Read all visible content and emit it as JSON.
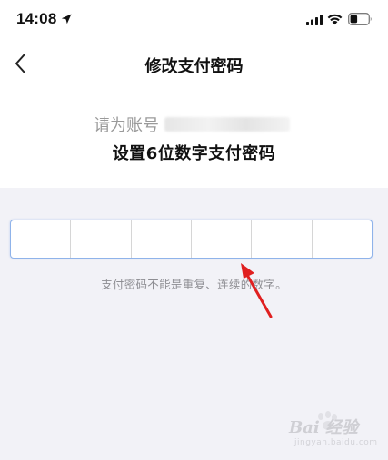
{
  "status_bar": {
    "time": "14:08"
  },
  "nav": {
    "title": "修改支付密码"
  },
  "prompt": {
    "prefix": "请为账号",
    "main": "设置6位数字支付密码"
  },
  "pin": {
    "length": 6
  },
  "hint": {
    "text": "支付密码不能是重复、连续的数字。"
  },
  "watermark": {
    "logo": "Bai 经验",
    "url": "jingyan.baidu.com"
  },
  "colors": {
    "page_bg": "#f2f2f7",
    "card_bg": "#ffffff",
    "pin_border": "#8fb3ea",
    "hint": "#8e8e93",
    "arrow": "#e02020"
  },
  "icons": {
    "back": "chevron-left-icon",
    "location": "location-arrow-icon",
    "signal": "cellular-signal-icon",
    "wifi": "wifi-icon",
    "battery": "battery-icon"
  }
}
